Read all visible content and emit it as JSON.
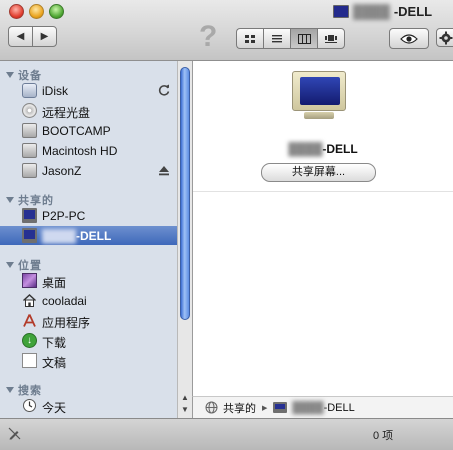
{
  "window": {
    "title_suffix": "-DELL",
    "title_blurred": "████"
  },
  "toolbar": {
    "back_icon": "◀",
    "forward_icon": "▶",
    "help_icon": "?",
    "views": [
      "icon-view",
      "list-view",
      "column-view",
      "coverflow-view"
    ],
    "active_view": "column-view"
  },
  "sidebar": {
    "sections": {
      "devices": "设备",
      "shared": "共享的",
      "places": "位置",
      "search": "搜索"
    },
    "devices": [
      {
        "label": "iDisk",
        "icon": "idisk-icon"
      },
      {
        "label": "远程光盘",
        "icon": "cd-icon"
      },
      {
        "label": "BOOTCAMP",
        "icon": "disk-icon"
      },
      {
        "label": "Macintosh HD",
        "icon": "disk-icon"
      },
      {
        "label": "JasonZ",
        "icon": "disk-icon"
      }
    ],
    "shared": [
      {
        "label": "P2P-PC",
        "icon": "monitor-icon"
      },
      {
        "label": "-DELL",
        "blurred": "████",
        "icon": "monitor-icon"
      }
    ],
    "places": [
      {
        "label": "桌面",
        "icon": "desktop-icon"
      },
      {
        "label": "cooladai",
        "icon": "home-icon"
      },
      {
        "label": "应用程序",
        "icon": "applications-icon"
      },
      {
        "label": "下载",
        "icon": "download-icon"
      },
      {
        "label": "文稿",
        "icon": "document-icon"
      }
    ],
    "search": [
      {
        "label": "今天",
        "icon": "clock-icon"
      }
    ]
  },
  "preview": {
    "computer_name_suffix": "-DELL",
    "computer_name_blurred": "████",
    "share_screen_label": "共享屏幕..."
  },
  "path_bar": {
    "root": "共享的",
    "leaf_suffix": "-DELL",
    "leaf_blurred": "████"
  },
  "status_bar": {
    "count": "0 项"
  }
}
